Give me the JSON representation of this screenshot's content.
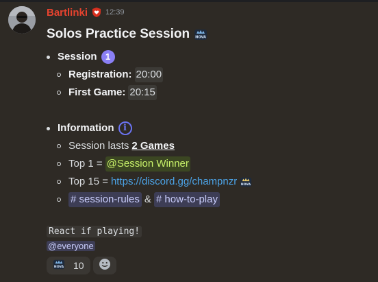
{
  "author": {
    "username": "Bartlinki",
    "timestamp": "12:39",
    "role_icon": "red-shield-heart-icon",
    "name_color": "#e8432f"
  },
  "message": {
    "title": "Solos Practice Session",
    "title_emoji": "nova-crown-icon",
    "session": {
      "label": "Session",
      "badge": "1",
      "registration_label": "Registration:",
      "registration_time": "20:00",
      "first_game_label": "First Game:",
      "first_game_time": "20:15"
    },
    "information": {
      "label": "Information",
      "info_icon": "info-icon",
      "lasts_prefix": "Session lasts",
      "lasts_value": "2 Games",
      "top1_prefix": "Top 1 =",
      "top1_role": "@Session Winner",
      "top15_prefix": "Top 15 =",
      "top15_link": "https://discord.gg/champnzr",
      "channel1": "session-rules",
      "connector": "&",
      "channel2": "how-to-play"
    },
    "react_text": "React if playing!",
    "mention": "@everyone"
  },
  "reactions": [
    {
      "emoji": "nova-icon",
      "count": "10"
    }
  ],
  "colors": {
    "background": "#2e2a25",
    "role_mention": "#c9f26a",
    "link": "#4ca4e8",
    "badge": "#8a7ff5"
  }
}
